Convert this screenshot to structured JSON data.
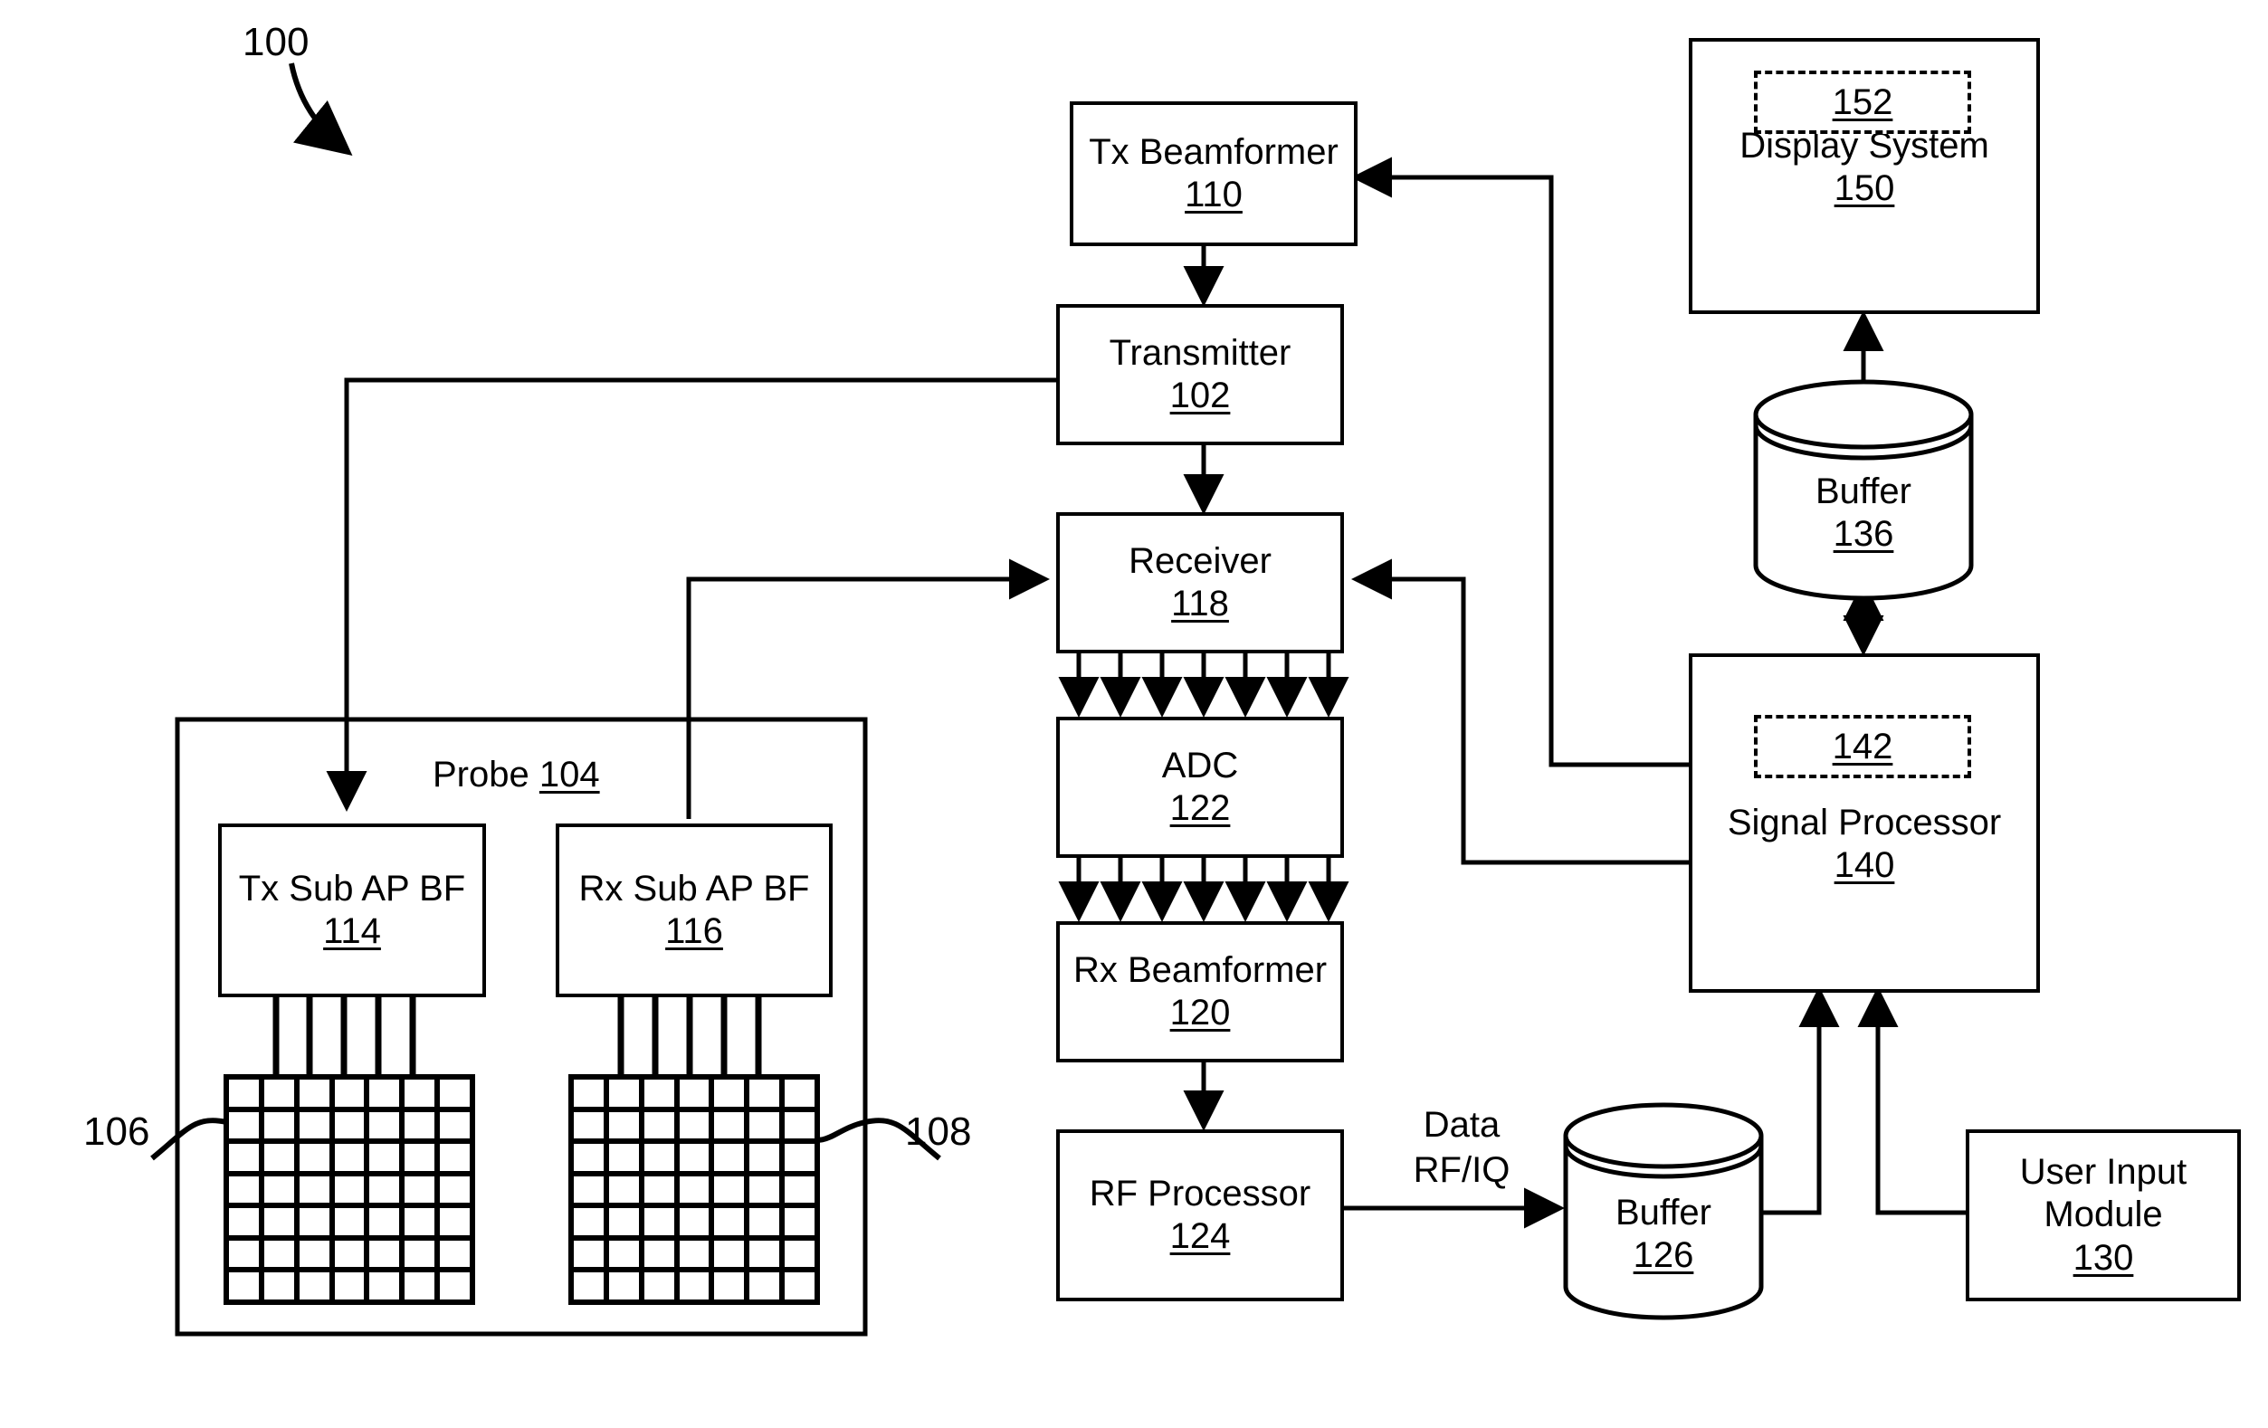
{
  "figure": {
    "ref_number": "100",
    "title_label": "100"
  },
  "blocks": {
    "tx_beamformer": {
      "label": "Tx Beamformer",
      "ref": "110"
    },
    "transmitter": {
      "label": "Transmitter",
      "ref": "102"
    },
    "receiver": {
      "label": "Receiver",
      "ref": "118"
    },
    "adc": {
      "label": "ADC",
      "ref": "122"
    },
    "rx_beamformer": {
      "label": "Rx Beamformer",
      "ref": "120"
    },
    "rf_processor": {
      "label": "RF Processor",
      "ref": "124"
    },
    "signal_processor": {
      "label": "Signal Processor",
      "ref": "140",
      "inner_ref": "142"
    },
    "display_system": {
      "label": "Display System",
      "ref": "150",
      "inner_ref": "152"
    },
    "user_input_module": {
      "label_line1": "User Input",
      "label_line2": "Module",
      "ref": "130"
    },
    "buffer_136": {
      "label": "Buffer",
      "ref": "136"
    },
    "buffer_126": {
      "label": "Buffer",
      "ref": "126"
    },
    "tx_sub_ap_bf": {
      "label": "Tx Sub AP BF",
      "ref": "114"
    },
    "rx_sub_ap_bf": {
      "label": "Rx Sub AP BF",
      "ref": "116"
    }
  },
  "probe": {
    "label": "Probe",
    "ref": "104",
    "tx_array_ref": "106",
    "rx_array_ref": "108",
    "array_columns": 7,
    "array_rows": 7,
    "connector_lines": 5
  },
  "edge_labels": {
    "data_rf_iq_line1": "Data",
    "data_rf_iq_line2": "RF/IQ"
  },
  "colors": {
    "stroke": "#000000",
    "background": "#ffffff"
  }
}
